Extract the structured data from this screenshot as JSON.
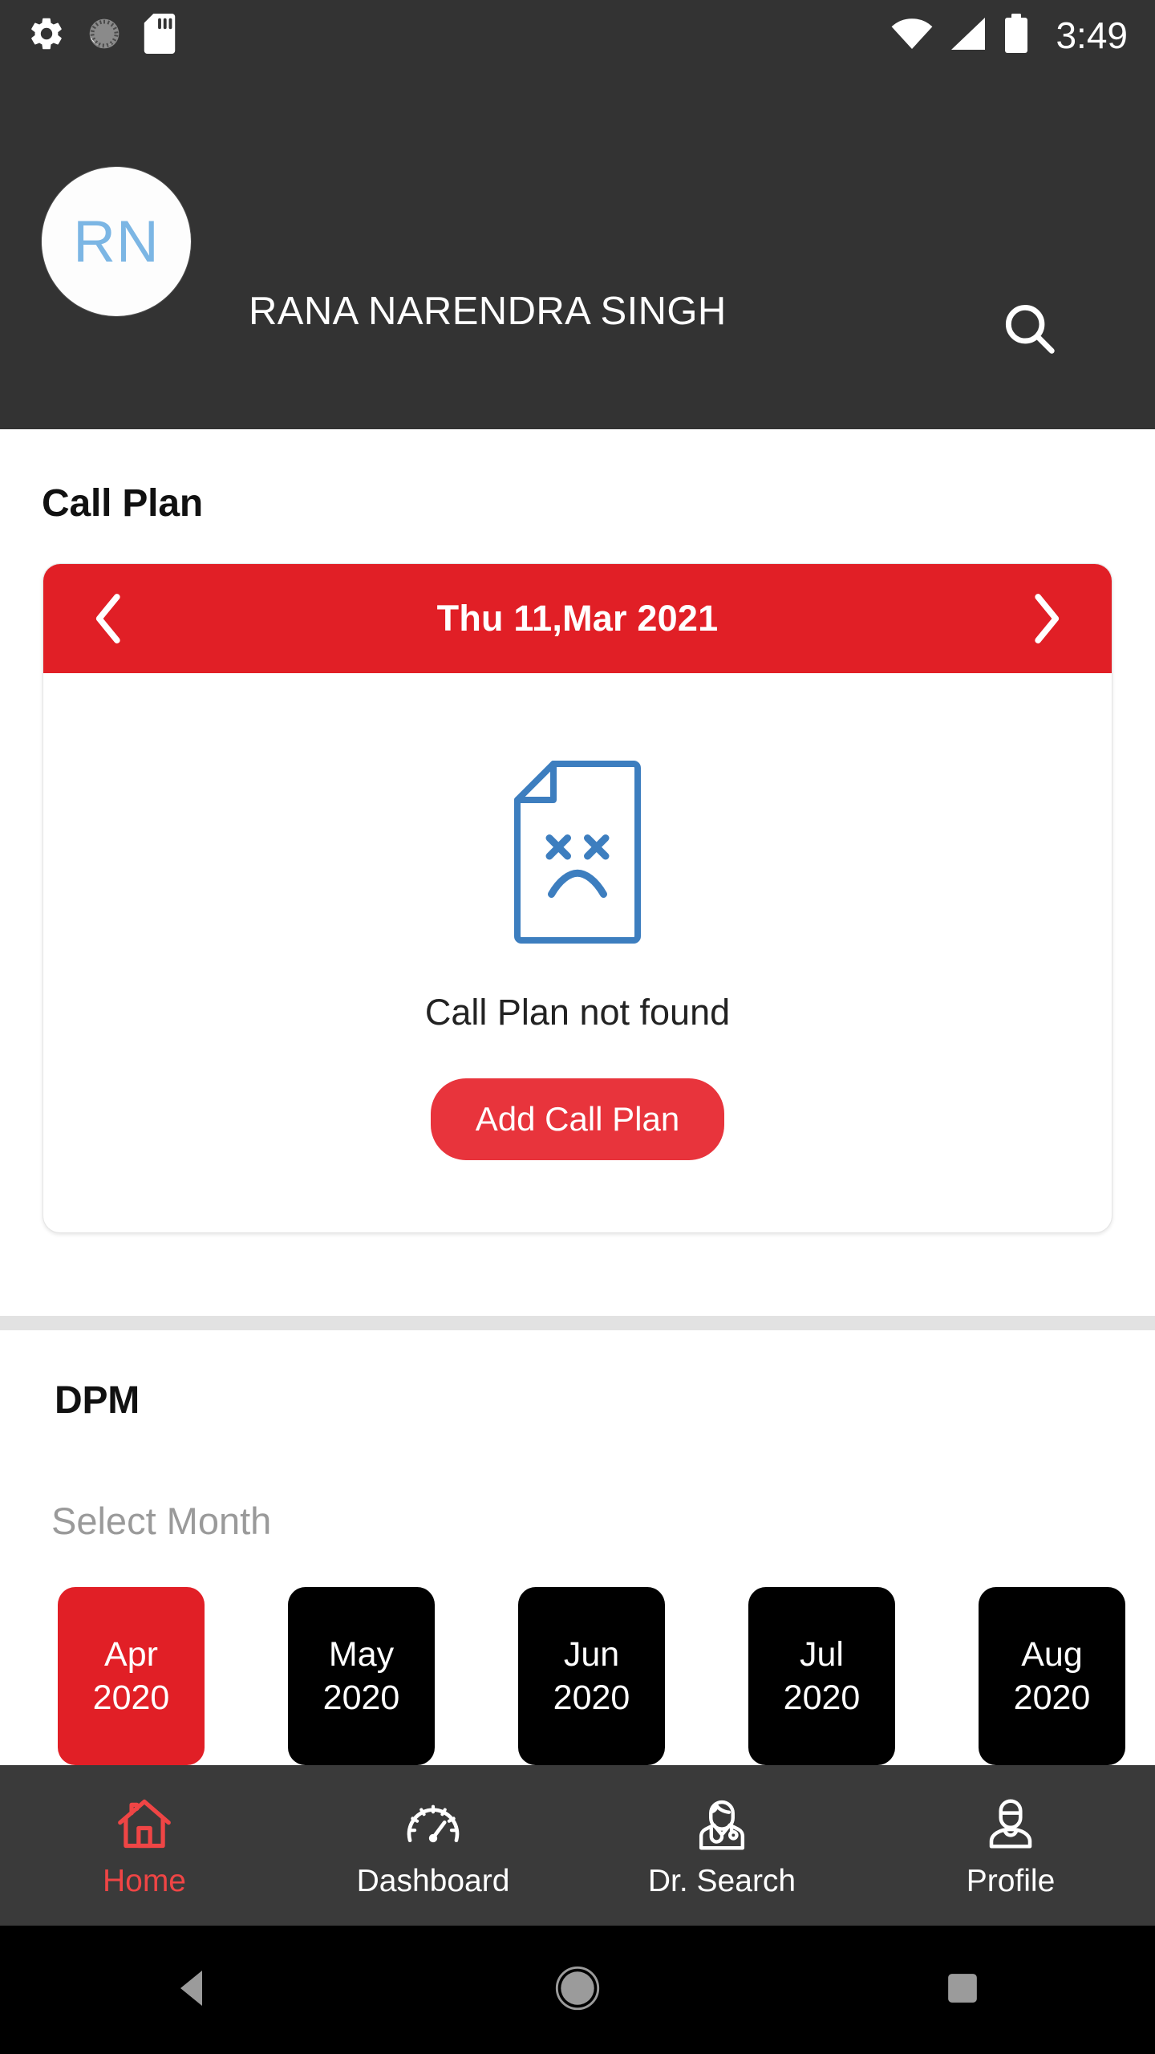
{
  "statusbar": {
    "clock": "3:49",
    "left_icons": [
      "settings-gear-icon",
      "loading-spinner-icon",
      "sd-card-icon"
    ],
    "right_icons": [
      "wifi-icon",
      "cellular-signal-icon",
      "battery-icon"
    ]
  },
  "header": {
    "avatar_initials": "RN",
    "title": "RANA NARENDRA SINGH",
    "search_icon": "search-icon",
    "background_color": "#333333",
    "avatar_text_color": "#7cb6e4"
  },
  "call_plan": {
    "section_title": "Call Plan",
    "prev_label": "‹",
    "next_label": "›",
    "date_label": "Thu 11,Mar 2021",
    "empty_icon": "document-sad-face-icon",
    "empty_message": "Call Plan not found",
    "add_button_label": "Add Call Plan",
    "accent_color": "#e11f26",
    "empty_icon_color": "#3d7ebf"
  },
  "dpm": {
    "section_title": "DPM",
    "select_month_label": "Select Month",
    "months": [
      {
        "month": "Apr",
        "year": "2020",
        "selected": true
      },
      {
        "month": "May",
        "year": "2020",
        "selected": false
      },
      {
        "month": "Jun",
        "year": "2020",
        "selected": false
      },
      {
        "month": "Jul",
        "year": "2020",
        "selected": false
      },
      {
        "month": "Aug",
        "year": "2020",
        "selected": false
      }
    ]
  },
  "bottom_nav": {
    "items": [
      {
        "label": "Home",
        "icon": "home-icon",
        "active": true
      },
      {
        "label": "Dashboard",
        "icon": "speedometer-icon",
        "active": false
      },
      {
        "label": "Dr. Search",
        "icon": "doctor-icon",
        "active": false
      },
      {
        "label": "Profile",
        "icon": "person-icon",
        "active": false
      }
    ],
    "active_color": "#ef4545",
    "background_color": "#3a3a3a"
  },
  "android_nav": {
    "back": "back-triangle-icon",
    "home": "home-circle-icon",
    "recents": "recents-square-icon"
  }
}
